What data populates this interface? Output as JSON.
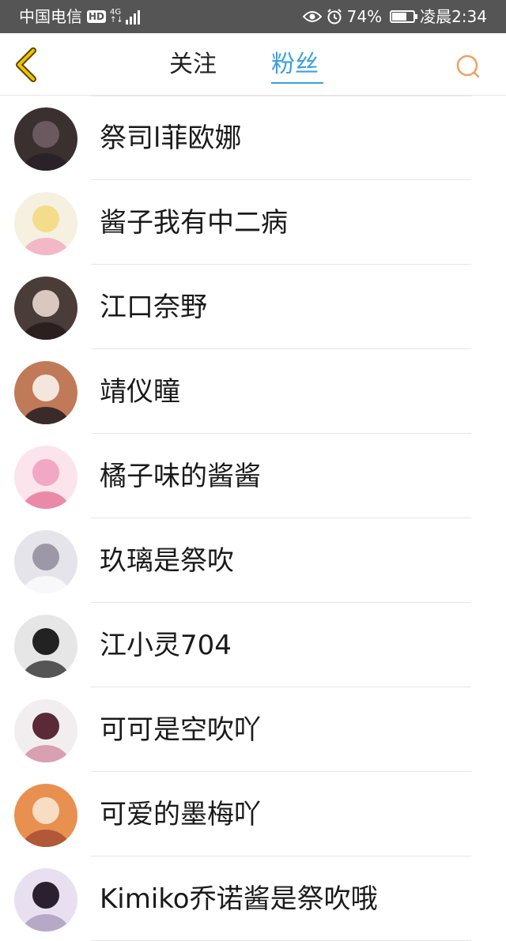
{
  "statusbar": {
    "carrier": "中国电信",
    "hd": "HD",
    "net_top": "4G",
    "net_bottom": "↑↓",
    "battery_percent": "74%",
    "battery_level": 0.74,
    "time": "凌晨2:34",
    "icons": [
      "eye-icon",
      "alarm-icon",
      "battery-icon"
    ]
  },
  "header": {
    "tabs": [
      {
        "label": "关注",
        "active": false
      },
      {
        "label": "粉丝",
        "active": true
      }
    ],
    "accent_color": "#3aa0e0",
    "back_icon_color": "#e8b800",
    "search_icon_color": "#f0a060"
  },
  "fans": [
    {
      "name": "祭司l菲欧娜",
      "avatar_colors": [
        "#3a3030",
        "#6a5a60",
        "#2a2228"
      ]
    },
    {
      "name": "酱子我有中二病",
      "avatar_colors": [
        "#f6f0e0",
        "#f3dc8a",
        "#f2b8c8"
      ]
    },
    {
      "name": "江口奈野",
      "avatar_colors": [
        "#4a3c38",
        "#d8c8c0",
        "#2a2020"
      ]
    },
    {
      "name": "靖仪瞳",
      "avatar_colors": [
        "#c07a58",
        "#f4e6dc",
        "#3a2a28"
      ]
    },
    {
      "name": "橘子味的酱酱",
      "avatar_colors": [
        "#fbe4ec",
        "#f2a8c4",
        "#e88aa8"
      ]
    },
    {
      "name": "玖璃是祭吹",
      "avatar_colors": [
        "#e4e4ea",
        "#9c98a8",
        "#f8f8fa"
      ]
    },
    {
      "name": "江小灵704",
      "avatar_colors": [
        "#e6e6e6",
        "#222222",
        "#555555"
      ]
    },
    {
      "name": "可可是空吹吖",
      "avatar_colors": [
        "#f2eef0",
        "#5a2a38",
        "#d8a0b0"
      ]
    },
    {
      "name": "可爱的墨梅吖",
      "avatar_colors": [
        "#e89050",
        "#f8dcc4",
        "#b05838"
      ]
    },
    {
      "name": "Kimiko乔诺酱是祭吹哦",
      "avatar_colors": [
        "#e8e0f0",
        "#2a2030",
        "#b8a8c8"
      ]
    }
  ]
}
